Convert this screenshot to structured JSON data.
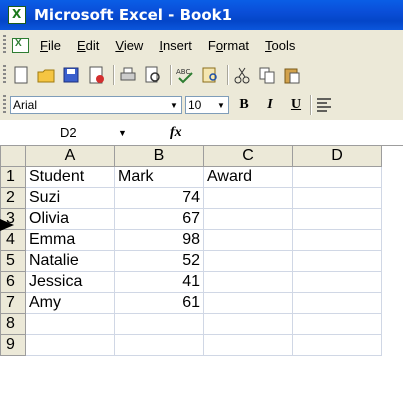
{
  "window": {
    "title": "Microsoft Excel - Book1"
  },
  "menu": [
    "File",
    "Edit",
    "View",
    "Insert",
    "Format",
    "Tools"
  ],
  "menu_underline": [
    "F",
    "E",
    "V",
    "I",
    "o",
    "T"
  ],
  "toolbar_icons": [
    "new-icon",
    "open-icon",
    "save-icon",
    "permission-icon",
    "print-icon",
    "print-preview-icon",
    "spelling-icon",
    "research-icon",
    "cut-icon",
    "copy-icon",
    "paste-icon"
  ],
  "format": {
    "font": "Arial",
    "size": "10",
    "bold": "B",
    "italic": "I",
    "underline": "U"
  },
  "formula": {
    "namebox": "D2",
    "fx": "fx",
    "content": ""
  },
  "columns": [
    "A",
    "B",
    "C",
    "D"
  ],
  "rows": [
    {
      "n": "1",
      "A": "Student",
      "B": "Mark",
      "C": "Award",
      "D": ""
    },
    {
      "n": "2",
      "A": "Suzi",
      "B": "74",
      "C": "",
      "D": ""
    },
    {
      "n": "3",
      "A": "Olivia",
      "B": "67",
      "C": "",
      "D": ""
    },
    {
      "n": "4",
      "A": "Emma",
      "B": "98",
      "C": "",
      "D": ""
    },
    {
      "n": "5",
      "A": "Natalie",
      "B": "52",
      "C": "",
      "D": ""
    },
    {
      "n": "6",
      "A": "Jessica",
      "B": "41",
      "C": "",
      "D": ""
    },
    {
      "n": "7",
      "A": "Amy",
      "B": "61",
      "C": "",
      "D": ""
    },
    {
      "n": "8",
      "A": "",
      "B": "",
      "C": "",
      "D": ""
    },
    {
      "n": "9",
      "A": "",
      "B": "",
      "C": "",
      "D": ""
    }
  ],
  "colors": {
    "titlebar": "#0a4ed8",
    "chrome": "#ece9d8",
    "gridline": "#d0d7e5"
  }
}
